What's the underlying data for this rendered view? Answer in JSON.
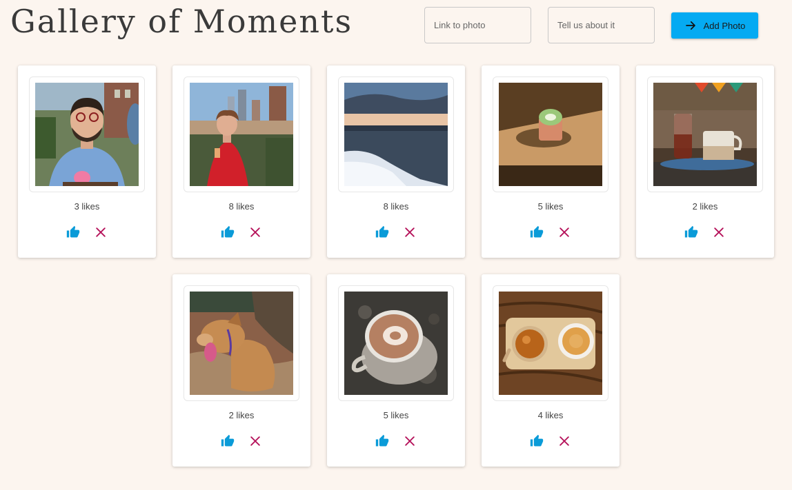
{
  "header": {
    "title": "Gallery of Moments",
    "link_placeholder": "Link to photo",
    "description_placeholder": "Tell us about it",
    "add_button_label": "Add Photo",
    "add_button_icon": "arrow-right-icon"
  },
  "colors": {
    "background": "#fcf5ef",
    "accent": "#05aaf2",
    "like": "#0a9bd8",
    "delete": "#b5125a"
  },
  "photos": [
    {
      "subject": "smiling man with pink cocktail",
      "likes": "3 likes",
      "like_icon": "thumbs-up-icon",
      "delete_icon": "close-icon"
    },
    {
      "subject": "woman in red dress on rooftop",
      "likes": "8 likes",
      "like_icon": "thumbs-up-icon",
      "delete_icon": "close-icon"
    },
    {
      "subject": "snowy lake shore at sunset",
      "likes": "8 likes",
      "like_icon": "thumbs-up-icon",
      "delete_icon": "close-icon"
    },
    {
      "subject": "matcha latte on wooden table",
      "likes": "5 likes",
      "like_icon": "thumbs-up-icon",
      "delete_icon": "close-icon"
    },
    {
      "subject": "carafe and mug on tray",
      "likes": "2 likes",
      "like_icon": "thumbs-up-icon",
      "delete_icon": "close-icon"
    },
    {
      "subject": "happy dog sticking out tongue",
      "likes": "2 likes",
      "like_icon": "thumbs-up-icon",
      "delete_icon": "close-icon"
    },
    {
      "subject": "latte art on granite counter",
      "likes": "5 likes",
      "like_icon": "thumbs-up-icon",
      "delete_icon": "close-icon"
    },
    {
      "subject": "tea set on wooden tray",
      "likes": "4 likes",
      "like_icon": "thumbs-up-icon",
      "delete_icon": "close-icon"
    }
  ]
}
